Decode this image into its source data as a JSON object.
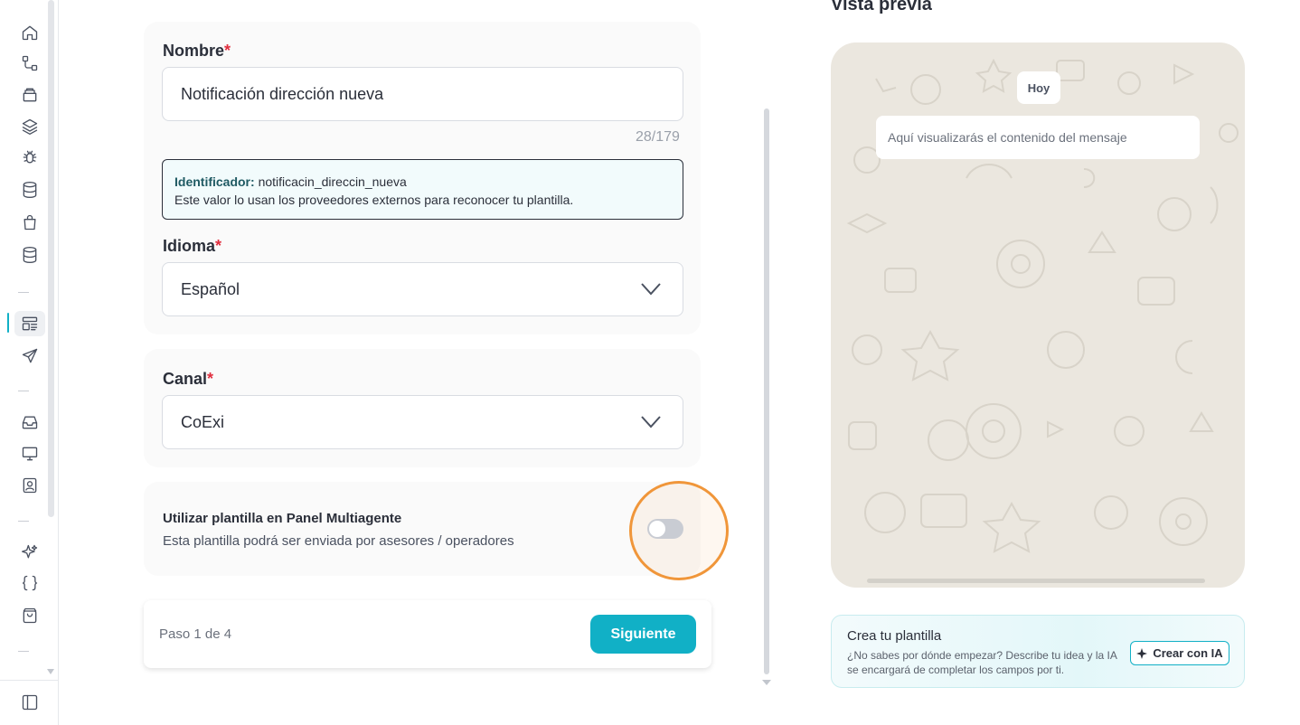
{
  "sidebar": {
    "icons": [
      "home-icon",
      "flow-icon",
      "archive-icon",
      "layers-icon",
      "bug-icon",
      "database-icon",
      "bag-icon",
      "database-alt-icon",
      "templates-icon",
      "send-icon",
      "inbox-icon",
      "monitor-icon",
      "contact-icon",
      "sparkles-icon",
      "code-braces-icon",
      "shopping-bag-icon",
      "panel-toggle-icon"
    ],
    "active": "templates-icon"
  },
  "form": {
    "name_label": "Nombre",
    "name_value": "Notificación dirección nueva",
    "name_counter": "28/179",
    "identifier_label": "Identificador:",
    "identifier_value": "notificacin_direccin_nueva",
    "identifier_note": "Este valor lo usan los proveedores externos para reconocer tu plantilla.",
    "language_label": "Idioma",
    "language_value": "Español",
    "channel_label": "Canal",
    "channel_value": "CoExi",
    "required_mark": "*",
    "multiagent_title": "Utilizar plantilla en Panel Multiagente",
    "multiagent_desc": "Esta plantilla podrá ser enviada por asesores / operadores",
    "multiagent_enabled": false
  },
  "footer": {
    "step": "Paso 1 de 4",
    "next_label": "Siguiente"
  },
  "preview": {
    "title": "Vista previa",
    "date_chip": "Hoy",
    "message_placeholder": "Aquí visualizarás el contenido del mensaje"
  },
  "ai": {
    "title": "Crea tu plantilla",
    "description": "¿No sabes por dónde empezar? Describe tu idea y la IA se encargará de completar los campos por ti.",
    "button_label": "Crear con IA"
  },
  "colors": {
    "accent": "#11b0c6",
    "required": "#e02e3e",
    "highlight": "#f0963a",
    "preview_bg": "#ebe7df"
  }
}
